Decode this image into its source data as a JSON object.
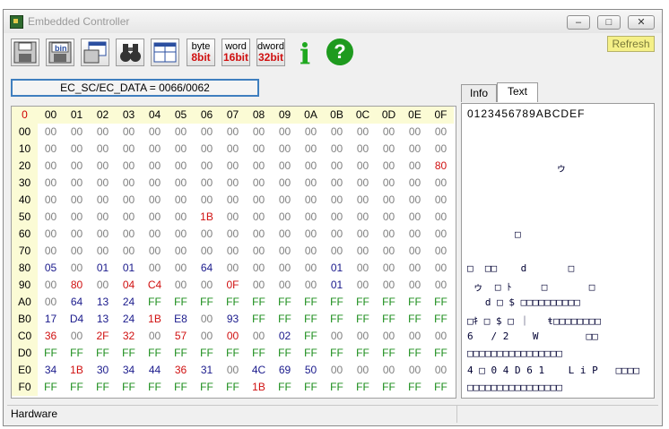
{
  "window": {
    "title": "Embedded Controller"
  },
  "window_controls": {
    "minimize": "–",
    "maximize": "□",
    "close": "✕"
  },
  "toolbar": {
    "byte_label": "byte",
    "byte_bits": "8bit",
    "word_label": "word",
    "word_bits": "16bit",
    "dword_label": "dword",
    "dword_bits": "32bit",
    "info_glyph": "i",
    "help_glyph": "?",
    "bin_label": "bin",
    "refresh_label": "Refresh"
  },
  "address": {
    "text": "EC_SC/EC_DATA = 0066/0062"
  },
  "grid": {
    "corner": "0",
    "col_headers": [
      "00",
      "01",
      "02",
      "03",
      "04",
      "05",
      "06",
      "07",
      "08",
      "09",
      "0A",
      "0B",
      "0C",
      "0D",
      "0E",
      "0F"
    ],
    "rows": [
      {
        "addr": "00",
        "cells": [
          "00",
          "00",
          "00",
          "00",
          "00",
          "00",
          "00",
          "00",
          "00",
          "00",
          "00",
          "00",
          "00",
          "00",
          "00",
          "00"
        ]
      },
      {
        "addr": "10",
        "cells": [
          "00",
          "00",
          "00",
          "00",
          "00",
          "00",
          "00",
          "00",
          "00",
          "00",
          "00",
          "00",
          "00",
          "00",
          "00",
          "00"
        ]
      },
      {
        "addr": "20",
        "cells": [
          "00",
          "00",
          "00",
          "00",
          "00",
          "00",
          "00",
          "00",
          "00",
          "00",
          "00",
          "00",
          "00",
          "00",
          "00",
          "80"
        ]
      },
      {
        "addr": "30",
        "cells": [
          "00",
          "00",
          "00",
          "00",
          "00",
          "00",
          "00",
          "00",
          "00",
          "00",
          "00",
          "00",
          "00",
          "00",
          "00",
          "00"
        ]
      },
      {
        "addr": "40",
        "cells": [
          "00",
          "00",
          "00",
          "00",
          "00",
          "00",
          "00",
          "00",
          "00",
          "00",
          "00",
          "00",
          "00",
          "00",
          "00",
          "00"
        ]
      },
      {
        "addr": "50",
        "cells": [
          "00",
          "00",
          "00",
          "00",
          "00",
          "00",
          "1B",
          "00",
          "00",
          "00",
          "00",
          "00",
          "00",
          "00",
          "00",
          "00"
        ]
      },
      {
        "addr": "60",
        "cells": [
          "00",
          "00",
          "00",
          "00",
          "00",
          "00",
          "00",
          "00",
          "00",
          "00",
          "00",
          "00",
          "00",
          "00",
          "00",
          "00"
        ]
      },
      {
        "addr": "70",
        "cells": [
          "00",
          "00",
          "00",
          "00",
          "00",
          "00",
          "00",
          "00",
          "00",
          "00",
          "00",
          "00",
          "00",
          "00",
          "00",
          "00"
        ]
      },
      {
        "addr": "80",
        "cells": [
          "05",
          "00",
          "01",
          "01",
          "00",
          "00",
          "64",
          "00",
          "00",
          "00",
          "00",
          "01",
          "00",
          "00",
          "00",
          "00"
        ]
      },
      {
        "addr": "90",
        "cells": [
          "00",
          "80",
          "00",
          "04",
          "C4",
          "00",
          "00",
          "0F",
          "00",
          "00",
          "00",
          "01",
          "00",
          "00",
          "00",
          "00"
        ]
      },
      {
        "addr": "A0",
        "cells": [
          "00",
          "64",
          "13",
          "24",
          "FF",
          "FF",
          "FF",
          "FF",
          "FF",
          "FF",
          "FF",
          "FF",
          "FF",
          "FF",
          "FF",
          "FF"
        ]
      },
      {
        "addr": "B0",
        "cells": [
          "17",
          "D4",
          "13",
          "24",
          "1B",
          "E8",
          "00",
          "93",
          "FF",
          "FF",
          "FF",
          "FF",
          "FF",
          "FF",
          "FF",
          "FF"
        ]
      },
      {
        "addr": "C0",
        "cells": [
          "36",
          "00",
          "2F",
          "32",
          "00",
          "57",
          "00",
          "00",
          "00",
          "02",
          "FF",
          "00",
          "00",
          "00",
          "00",
          "00"
        ]
      },
      {
        "addr": "D0",
        "cells": [
          "FF",
          "FF",
          "FF",
          "FF",
          "FF",
          "FF",
          "FF",
          "FF",
          "FF",
          "FF",
          "FF",
          "FF",
          "FF",
          "FF",
          "FF",
          "FF"
        ]
      },
      {
        "addr": "E0",
        "cells": [
          "34",
          "1B",
          "30",
          "34",
          "44",
          "36",
          "31",
          "00",
          "4C",
          "69",
          "50",
          "00",
          "00",
          "00",
          "00",
          "00"
        ]
      },
      {
        "addr": "F0",
        "cells": [
          "FF",
          "FF",
          "FF",
          "FF",
          "FF",
          "FF",
          "FF",
          "FF",
          "1B",
          "FF",
          "FF",
          "FF",
          "FF",
          "FF",
          "FF",
          "FF"
        ]
      }
    ],
    "colors": {
      "zero": "#808080",
      "blue": "#1a1a8c",
      "red": "#d01010",
      "green": "#1a8c1a"
    },
    "red_values": [
      "80",
      "1B",
      "04",
      "C4",
      "0F",
      "36",
      "2F",
      "32",
      "57"
    ],
    "green_values": [
      "FF"
    ],
    "red_zero_cells": [
      "C0:7"
    ]
  },
  "tabs": [
    {
      "label": "Info"
    },
    {
      "label": "Text"
    }
  ],
  "text_panel": {
    "header": "0123456789ABCDEF",
    "lines": [
      "",
      "",
      "               ゥ",
      "",
      "",
      "",
      "        □",
      "",
      "□  □□    d       □",
      " ゥ  □ ﾄ     □       □",
      "   d □ $ □□□□□□□□□□",
      "□ｷ □ $ □ ｜   ŧ□□□□□□□□",
      "6   / 2    W        □□",
      "□□□□□□□□□□□□□□□□",
      "4 □ 0 4 D 6 1    L i P   □□□□",
      "□□□□□□□□□□□□□□□□"
    ]
  },
  "status": {
    "text": "Hardware"
  }
}
